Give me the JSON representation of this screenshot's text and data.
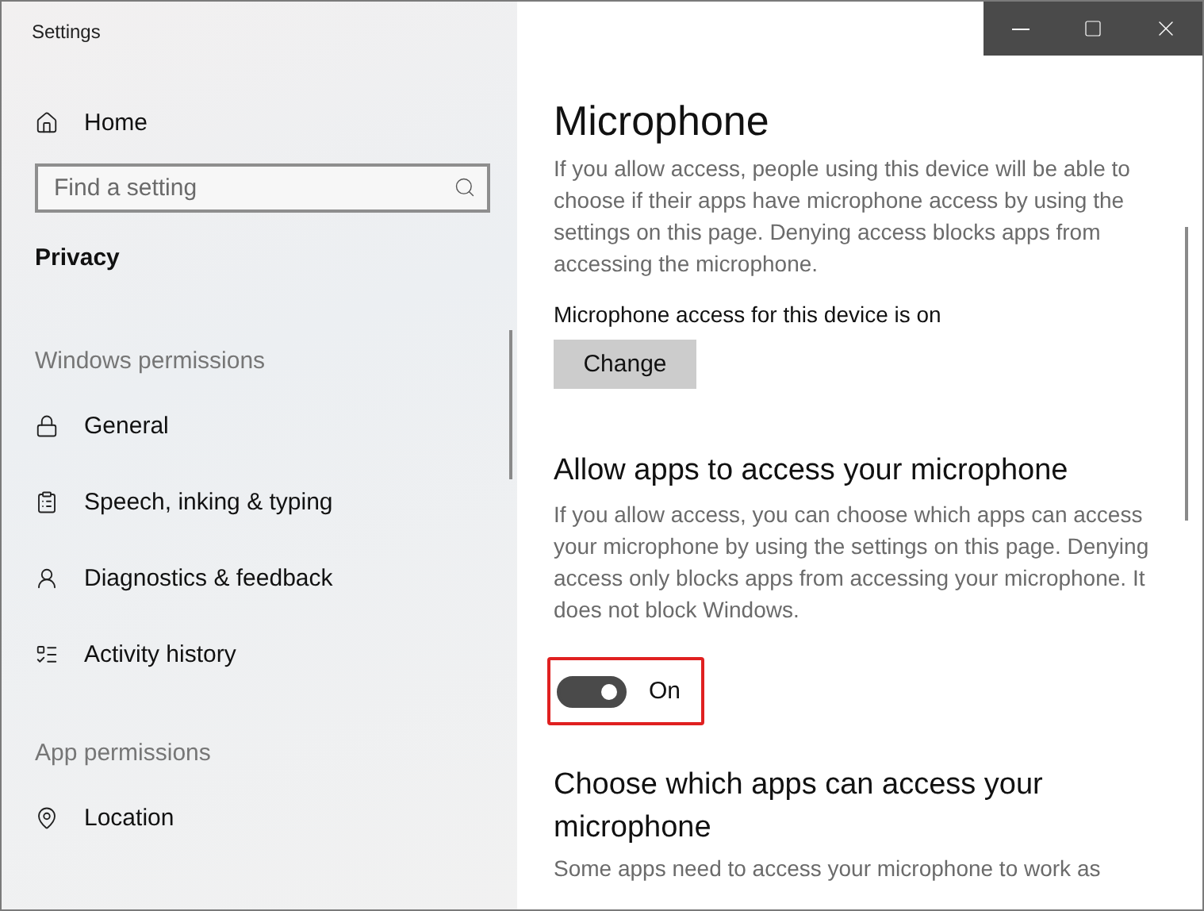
{
  "window": {
    "title": "Settings"
  },
  "sidebar": {
    "home": "Home",
    "search": {
      "placeholder": "Find a setting"
    },
    "section_title": "Privacy",
    "groups": [
      {
        "heading": "Windows permissions",
        "items": [
          {
            "label": "General",
            "selected": false
          },
          {
            "label": "Speech, inking & typing",
            "selected": false
          },
          {
            "label": "Diagnostics & feedback",
            "selected": false
          },
          {
            "label": "Activity history",
            "selected": false
          }
        ]
      },
      {
        "heading": "App permissions",
        "items": [
          {
            "label": "Location",
            "selected": false
          }
        ]
      }
    ]
  },
  "content": {
    "title": "Microphone",
    "intro": "If you allow access, people using this device will be able to choose if their apps have microphone access by using the settings on this page. Denying access blocks apps from accessing the microphone.",
    "device_status": "Microphone access for this device is on",
    "change_button": "Change",
    "allow_heading": "Allow apps to access your microphone",
    "allow_text": "If you allow access, you can choose which apps can access your microphone by using the settings on this page. Denying access only blocks apps from accessing your microphone. It does not block Windows.",
    "toggle": {
      "label": "On",
      "on": true,
      "highlighted": true
    },
    "choose_heading": "Choose which apps can access your microphone",
    "choose_text": "Some apps need to access your microphone to work as"
  }
}
